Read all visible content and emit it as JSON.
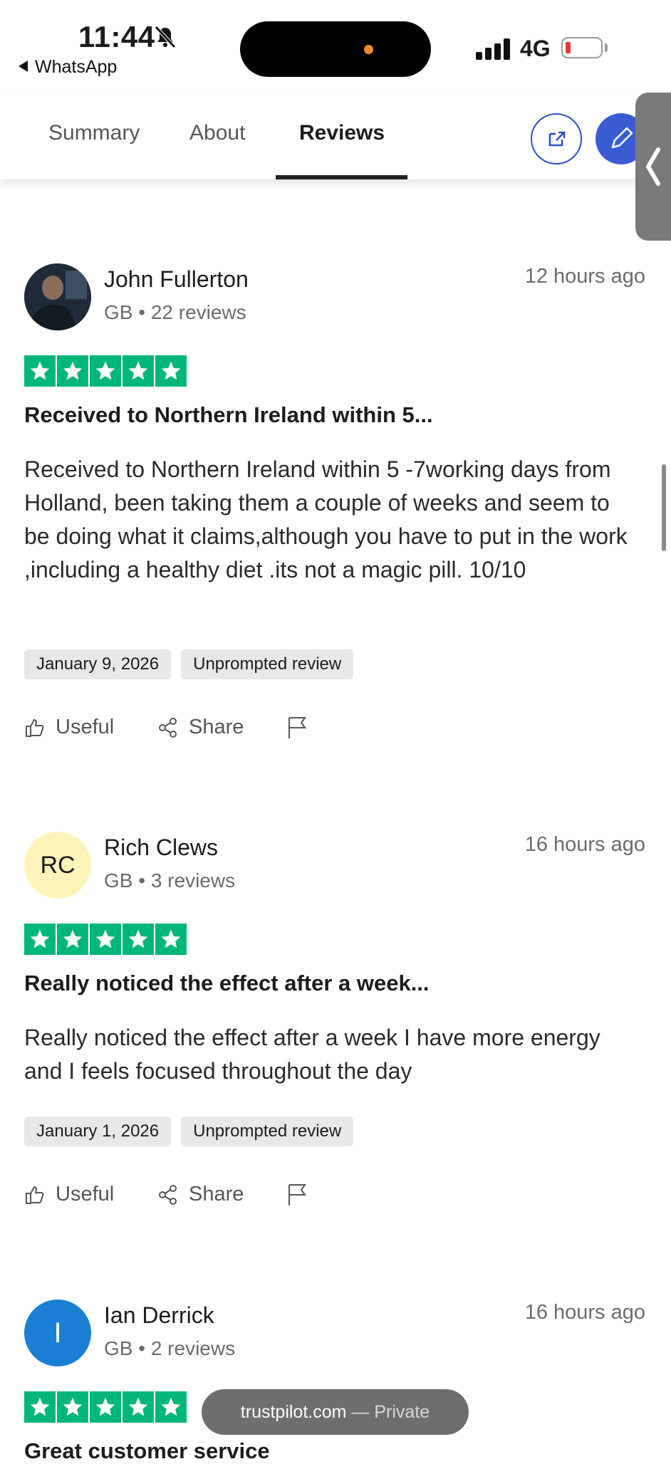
{
  "status_bar": {
    "time": "11:44",
    "back_app": "WhatsApp",
    "network": "4G",
    "battery_color": "#e53935"
  },
  "tabs": {
    "summary": "Summary",
    "about": "About",
    "reviews": "Reviews",
    "active": "Reviews"
  },
  "reviews": [
    {
      "avatar_initials": "",
      "avatar_style": "photo",
      "name": "John Fullerton",
      "meta": "GB • 22 reviews",
      "ago": "12 hours ago",
      "rating": 5,
      "title": "Received to Northern Ireland within 5...",
      "body": "Received to Northern Ireland within 5 -7working days from Holland, been taking them a couple of weeks and seem to be doing what it claims,although you have to put in the work ,including a healthy diet .its not a magic pill. 10/10",
      "date": "January 9, 2026",
      "tag": "Unprompted review",
      "useful_label": "Useful",
      "share_label": "Share"
    },
    {
      "avatar_initials": "RC",
      "avatar_style": "initials",
      "avatar_bg": "#fff4b8",
      "name": "Rich Clews",
      "meta": "GB • 3 reviews",
      "ago": "16 hours ago",
      "rating": 5,
      "title": "Really noticed the effect after a week...",
      "body": "Really noticed the effect after a week I have more energy and I feels focused throughout the day",
      "date": "January 1, 2026",
      "tag": "Unprompted review",
      "useful_label": "Useful",
      "share_label": "Share"
    },
    {
      "avatar_initials": "I",
      "avatar_style": "initials",
      "avatar_bg": "#1a7fd4",
      "name": "Ian Derrick",
      "meta": "GB • 2 reviews",
      "ago": "16 hours ago",
      "rating": 5,
      "title": "Great customer service"
    }
  ],
  "browser_pill": {
    "domain": "trustpilot.com",
    "mode": "— Private"
  },
  "colors": {
    "star_green": "#00b67a",
    "accent_blue": "#3b5bd5"
  }
}
